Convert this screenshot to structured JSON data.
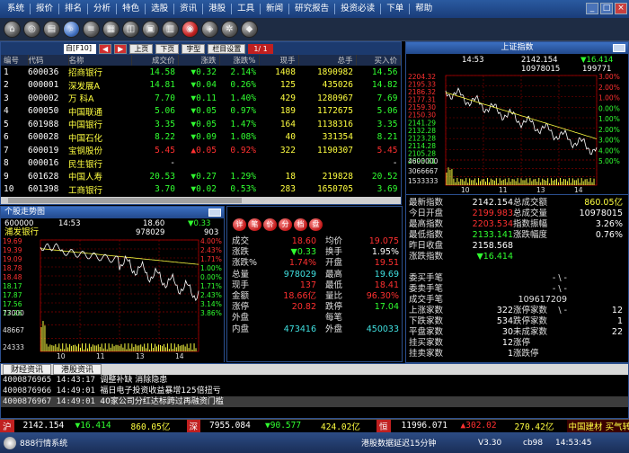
{
  "menu": [
    "系统",
    "报价",
    "排名",
    "分析",
    "特色",
    "选股",
    "资讯",
    "港股",
    "工具",
    "新闻",
    "研究报告",
    "投资必读",
    "下单",
    "帮助"
  ],
  "window_controls": [
    "_",
    "□",
    "×"
  ],
  "toolbar_icons": [
    "home-icon",
    "globe-icon",
    "chart-icon",
    "search-icon",
    "list-icon",
    "grid-icon",
    "split-icon",
    "news-icon",
    "calc-icon",
    "alarm-icon",
    "warn-icon",
    "gear-icon",
    "info-icon"
  ],
  "quote_list": {
    "filter_label": "自[F10]",
    "buttons": [
      "上页",
      "下页",
      "字型",
      "栏目设置"
    ],
    "page": "1/ 1",
    "headers": [
      "编号",
      "代码",
      "名称",
      "成交价",
      "涨跌",
      "涨跌%",
      "现手",
      "总手",
      "买入价"
    ],
    "rows": [
      {
        "no": "1",
        "code": "600036",
        "name": "招商银行",
        "price": "14.58",
        "chg": "▼0.32",
        "pct": "2.14%",
        "vol": "1408",
        "total": "1890982",
        "bid": "14.56",
        "dir": "dn"
      },
      {
        "no": "2",
        "code": "000001",
        "name": "深发展A",
        "price": "14.81",
        "chg": "▼0.04",
        "pct": "0.26%",
        "vol": "125",
        "total": "435026",
        "bid": "14.82",
        "dir": "dn"
      },
      {
        "no": "3",
        "code": "000002",
        "name": "万 科A",
        "price": "7.70",
        "chg": "▼0.11",
        "pct": "1.40%",
        "vol": "429",
        "total": "1280967",
        "bid": "7.69",
        "dir": "dn"
      },
      {
        "no": "4",
        "code": "600050",
        "name": "中国联通",
        "price": "5.06",
        "chg": "▼0.05",
        "pct": "0.97%",
        "vol": "189",
        "total": "1172675",
        "bid": "5.06",
        "dir": "dn"
      },
      {
        "no": "5",
        "code": "601988",
        "name": "中国银行",
        "price": "3.35",
        "chg": "▼0.05",
        "pct": "1.47%",
        "vol": "164",
        "total": "1138316",
        "bid": "3.35",
        "dir": "dn"
      },
      {
        "no": "6",
        "code": "600028",
        "name": "中国石化",
        "price": "8.22",
        "chg": "▼0.09",
        "pct": "1.08%",
        "vol": "40",
        "total": "331354",
        "bid": "8.21",
        "dir": "dn"
      },
      {
        "no": "7",
        "code": "600019",
        "name": "宝钢股份",
        "price": "5.45",
        "chg": "▲0.05",
        "pct": "0.92%",
        "vol": "322",
        "total": "1190307",
        "bid": "5.45",
        "dir": "up"
      },
      {
        "no": "8",
        "code": "000016",
        "name": "民生银行",
        "price": "-",
        "chg": "",
        "pct": "",
        "vol": "",
        "total": "",
        "bid": "-",
        "dir": "wh"
      },
      {
        "no": "9",
        "code": "601628",
        "name": "中国人寿",
        "price": "20.53",
        "chg": "▼0.27",
        "pct": "1.29%",
        "vol": "18",
        "total": "219828",
        "bid": "20.52",
        "dir": "dn"
      },
      {
        "no": "10",
        "code": "601398",
        "name": "工商银行",
        "price": "3.70",
        "chg": "▼0.02",
        "pct": "0.53%",
        "vol": "283",
        "total": "1650705",
        "bid": "3.69",
        "dir": "dn"
      }
    ]
  },
  "index_panel": {
    "title": "上证指数",
    "time": "14:53",
    "value": "2142.154",
    "chg": "▼16.414",
    "amount": "10978015",
    "vol": "199771",
    "y_left": [
      "2204.32",
      "2195.33",
      "2186.32",
      "2177.31",
      "2159.30",
      "2150.30",
      "2141.29",
      "2132.28",
      "2123.28",
      "2114.28",
      "2105.28",
      "2093.81",
      "4600000",
      "3066667",
      "1533333"
    ],
    "y_right": [
      "3.00%",
      "2.00%",
      "1.00%",
      "0.00%",
      "1.00%",
      "2.00%",
      "3.00%",
      "4.00%",
      "5.00%"
    ],
    "x_labels": [
      "10",
      "11",
      "13",
      "14"
    ]
  },
  "index_stats": {
    "rows": [
      [
        "最新指数",
        "2142.154",
        "总成交额",
        "860.05亿"
      ],
      [
        "今日开盘",
        "2199.983",
        "总成交量",
        "10978015"
      ],
      [
        "最高指数",
        "2203.534",
        "指数振幅",
        "3.26%"
      ],
      [
        "最低指数",
        "2133.141",
        "涨跌幅度",
        "0.76%"
      ],
      [
        "昨日收盘",
        "2158.568",
        "",
        ""
      ],
      [
        "涨跌指数",
        "▼16.414",
        "",
        ""
      ],
      [
        "",
        "",
        "",
        ""
      ],
      [
        "委买手笔",
        "",
        "- \\ -",
        ""
      ],
      [
        "委卖手笔",
        "",
        "- \\ -",
        ""
      ],
      [
        "成交手笔",
        "",
        "109617209 \\ -",
        ""
      ],
      [
        "上涨家数",
        "322",
        "涨停家数",
        "12"
      ],
      [
        "下跌家数",
        "534",
        "跌停家数",
        "1"
      ],
      [
        "平盘家数",
        "30",
        "未成家数",
        "22"
      ],
      [
        "挂买家数",
        "12",
        "涨停",
        ""
      ],
      [
        "挂卖家数",
        "1",
        "涨跌停",
        ""
      ]
    ]
  },
  "trend": {
    "title": "个股走势图",
    "code": "600000",
    "name": "浦发银行",
    "time": "14:53",
    "price": "18.60",
    "chg": "▼0.33",
    "amount": "978029",
    "vol": "903",
    "y_left": [
      "19.69",
      "19.39",
      "19.09",
      "18.78",
      "18.48",
      "18.17",
      "17.87",
      "17.56",
      "17.26",
      "73000",
      "48667",
      "24333"
    ],
    "y_right": [
      "4.00%",
      "2.43%",
      "1.71%",
      "1.00%",
      "0.00%",
      "1.71%",
      "2.43%",
      "3.14%",
      "3.86%"
    ],
    "x_labels": [
      "10",
      "11",
      "13",
      "14"
    ]
  },
  "detail": {
    "tabs": [
      "详",
      "笔",
      "价",
      "分",
      "档",
      "盘"
    ],
    "rows": [
      [
        "成交",
        "18.60",
        "均价",
        "19.075"
      ],
      [
        "涨跌",
        "▼0.33",
        "换手",
        "1.95%"
      ],
      [
        "涨跌%",
        "1.74%",
        "开盘",
        "19.51"
      ],
      [
        "总量",
        "978029",
        "最高",
        "19.69"
      ],
      [
        "现手",
        "137",
        "最低",
        "18.41"
      ],
      [
        "金额",
        "18.66亿",
        "量比",
        "96.30%"
      ],
      [
        "涨停",
        "20.82",
        "跌停",
        "17.04"
      ],
      [
        "外盘",
        "",
        "每笔",
        ""
      ],
      [
        "内盘",
        "473416",
        "外盘",
        "450033"
      ]
    ]
  },
  "news": {
    "tabs": [
      "财经资讯",
      "港股资讯"
    ],
    "lines": [
      {
        "id": "4000876965",
        "time": "14:43:17",
        "text": "调整补缺 消除隐患"
      },
      {
        "id": "4000876966",
        "time": "14:49:01",
        "text": "福日电子投资收益暴增125倍扭亏"
      },
      {
        "id": "4000876967",
        "time": "14:49:01",
        "text": "40家公司分红达标跨过再融资门槛"
      }
    ]
  },
  "ticker": [
    {
      "tag": "沪",
      "val": "2142.154",
      "chg": "▼16.414",
      "amt": "860.05亿"
    },
    {
      "tag": "深",
      "val": "7955.084",
      "chg": "▼90.577",
      "amt": "424.02亿"
    },
    {
      "tag": "恒",
      "val": "11996.071",
      "chg": "▲302.02",
      "amt": "270.42亿"
    }
  ],
  "ticker_news": "中国建材 买气转强星",
  "status": {
    "app": "888行情系统",
    "delay": "港股数据延迟15分钟",
    "version": "V3.30",
    "code": "cb98",
    "clock": "14:53:45"
  },
  "colors": {
    "up": "#ff3030",
    "down": "#30ff30",
    "accent": "#2b4f8f",
    "title_bar": "#3b6fc2"
  }
}
